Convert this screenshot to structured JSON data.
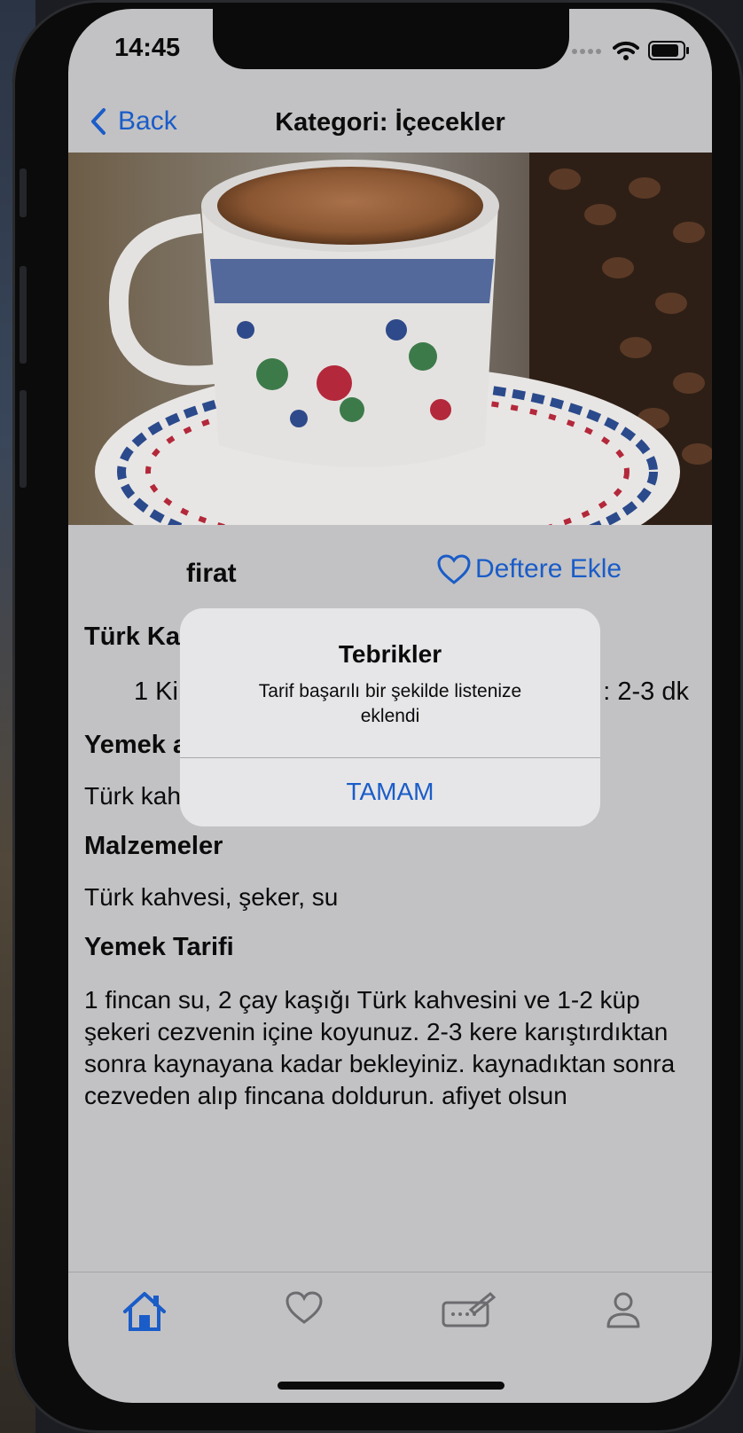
{
  "status_bar": {
    "time": "14:45"
  },
  "nav": {
    "back_label": "Back",
    "title": "Kategori: İçecekler"
  },
  "recipe": {
    "author": "firat",
    "add_label": "Deftere Ekle",
    "name_heading": "Türk Ka",
    "serving_partial": "1  Ki",
    "time_partial": ": 2-3 dk",
    "about_heading": "Yemek a",
    "about_partial": "Türk kah",
    "ingredients_heading": "Malzemeler",
    "ingredients": "Türk kahvesi, şeker, su",
    "instructions_heading": "Yemek Tarifi",
    "instructions": "1 fincan su, 2 çay kaşığı Türk kahvesini ve 1-2 küp şekeri cezvenin içine koyunuz. 2-3 kere karıştırdıktan sonra kaynayana kadar bekleyiniz. kaynadıktan sonra cezveden alıp fincana doldurun. afiyet olsun"
  },
  "alert": {
    "title": "Tebrikler",
    "message": "Tarif başarılı bir şekilde listenize eklendi",
    "button": "TAMAM"
  },
  "tabbar": {
    "items": [
      "home-icon",
      "heart-icon",
      "keyboard-edit-icon",
      "person-icon"
    ],
    "active_index": 0
  },
  "colors": {
    "accent": "#1a5cc8",
    "dimmed_background": "#c2c2c4",
    "alert_background": "#e6e6e8"
  }
}
